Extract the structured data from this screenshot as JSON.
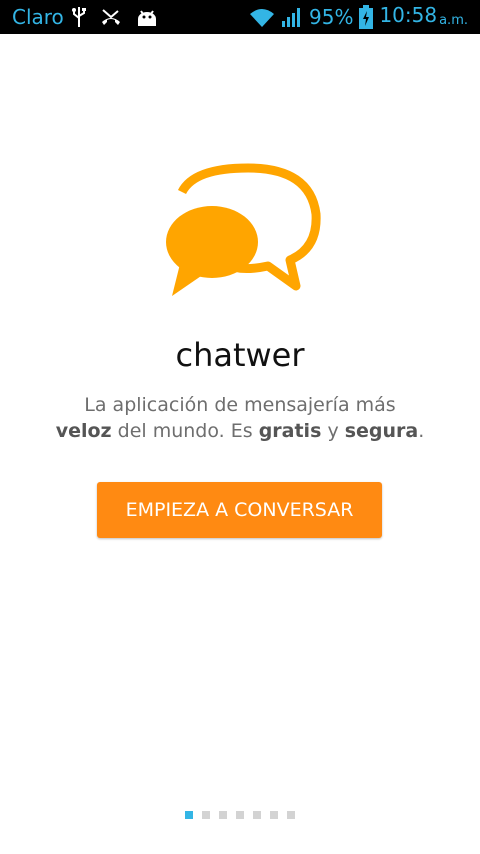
{
  "status_bar": {
    "carrier": "Claro",
    "icons_left": [
      "usb-icon",
      "missed-call-icon",
      "android-debug-icon"
    ],
    "icons_right": [
      "wifi-icon",
      "signal-icon",
      "battery-charging-icon"
    ],
    "battery": "95%",
    "time": "10:58",
    "ampm": "a.m.",
    "accent_color": "#33b5e5"
  },
  "app": {
    "title": "chatwer",
    "tagline": {
      "part1": "La aplicación de mensajería más",
      "veloz": "veloz",
      "part2": "del mundo. Es",
      "gratis": "gratis",
      "y": "y",
      "segura": "segura",
      "period": "."
    },
    "logo_color": "#ffa500"
  },
  "cta": {
    "label": "EMPIEZA A CONVERSAR",
    "color": "#ff8a12"
  },
  "pager": {
    "pages": 7,
    "active_index": 0
  }
}
